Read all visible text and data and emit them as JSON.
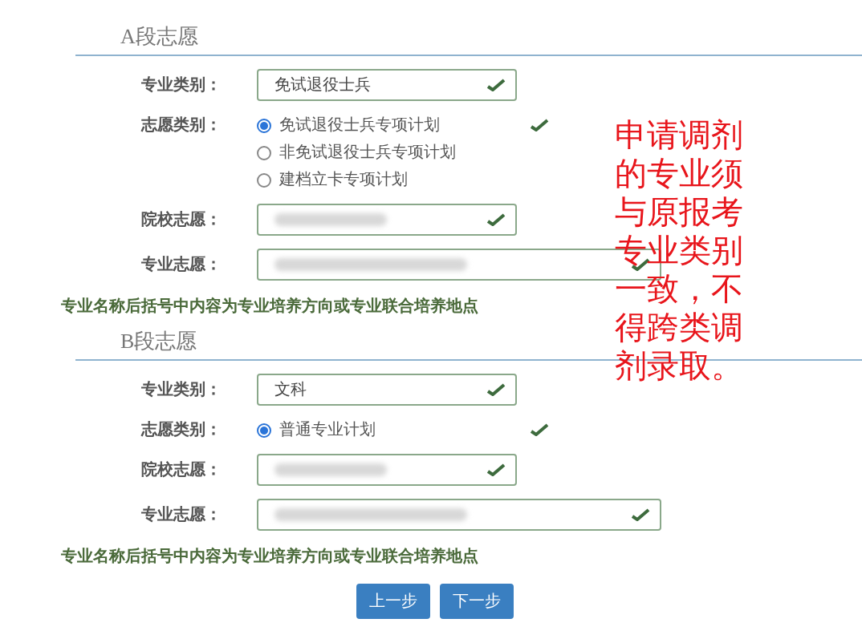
{
  "sections": [
    {
      "title": "A段志愿",
      "rows": [
        {
          "kind": "select",
          "label": "专业类别：",
          "value": "免试退役士兵",
          "redacted": false,
          "wide": false,
          "valid": true
        },
        {
          "kind": "radio",
          "label": "志愿类别：",
          "valid": true,
          "options": [
            {
              "label": "免试退役士兵专项计划",
              "selected": true
            },
            {
              "label": "非免试退役士兵专项计划",
              "selected": false
            },
            {
              "label": "建档立卡专项计划",
              "selected": false
            }
          ]
        },
        {
          "kind": "select",
          "label": "院校志愿：",
          "redacted": true,
          "wide": false,
          "valid": true
        },
        {
          "kind": "select",
          "label": "专业志愿：",
          "redacted": true,
          "wide": true,
          "valid": true
        }
      ],
      "note": "专业名称后括号中内容为专业培养方向或专业联合培养地点"
    },
    {
      "title": "B段志愿",
      "rows": [
        {
          "kind": "select",
          "label": "专业类别：",
          "value": "文科",
          "redacted": false,
          "wide": false,
          "valid": true
        },
        {
          "kind": "radio",
          "label": "志愿类别：",
          "valid": true,
          "options": [
            {
              "label": "普通专业计划",
              "selected": true
            }
          ]
        },
        {
          "kind": "select",
          "label": "院校志愿：",
          "redacted": true,
          "wide": false,
          "valid": true
        },
        {
          "kind": "select",
          "label": "专业志愿：",
          "redacted": true,
          "wide": true,
          "valid": true
        }
      ],
      "note": "专业名称后括号中内容为专业培养方向或专业联合培养地点"
    }
  ],
  "buttons": [
    "上一步",
    "下一步"
  ],
  "annotation": "申请调剂的专业须与原报考专业类别一致，不得跨类调剂录取。"
}
